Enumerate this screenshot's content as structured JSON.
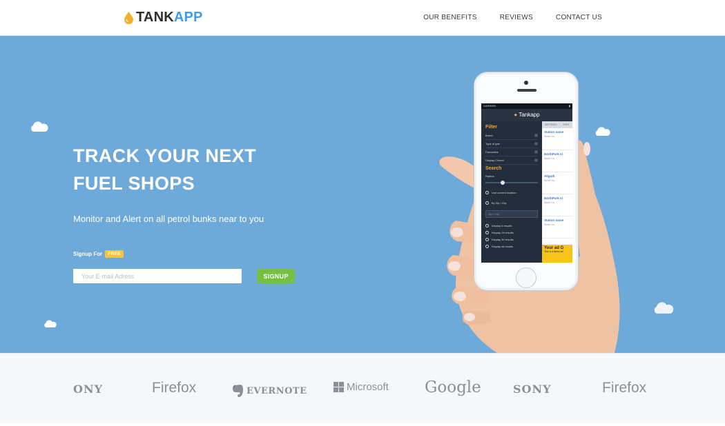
{
  "header": {
    "logo_part1": "TANK",
    "logo_part2": "APP",
    "nav": [
      "OUR BENEFITS",
      "REVIEWS",
      "CONTACT US"
    ]
  },
  "hero": {
    "headline_line1": "TRACK YOUR NEXT",
    "headline_line2": "FUEL SHOPS",
    "subline": "Monitor and Alert on all petrol bunks near to you",
    "signup_for": "Signup For",
    "free_badge": "FREE",
    "email_placeholder": "Your E-mail Adress",
    "signup_button": "SIGNUP"
  },
  "phone": {
    "carrier": "CARRIER",
    "app_title": "Tankapp",
    "filter_title": "Filter",
    "filter_rows": [
      "Brand",
      "Type of gas",
      "Favourites",
      "Display Closed"
    ],
    "search_title": "Search",
    "radius_label": "Radius",
    "options": [
      "Use current location",
      "By Zip / City"
    ],
    "city_placeholder": "Zip / City",
    "display_options": [
      "Display 5 results",
      "Display 25 results",
      "Display 50 results",
      "Display all results"
    ],
    "tabs_right": [
      "SETTINGS",
      "SORT"
    ],
    "results": [
      {
        "name": "Station name",
        "detail": "Street No."
      },
      {
        "name": "NorthPark st",
        "detail": "Street No."
      },
      {
        "name": "Allguth",
        "detail": "Street No."
      },
      {
        "name": "NorthPark st",
        "detail": "Street No."
      },
      {
        "name": "Station name",
        "detail": "Street No."
      }
    ],
    "ad_title": "Your ad G",
    "ad_sub": "This is a demo ad"
  },
  "logos": [
    "ONY",
    "Firefox",
    "EVERNOTE",
    "Microsoft",
    "Google",
    "SONY",
    "Firefox"
  ],
  "colors": {
    "hero_bg": "#6eaad9",
    "accent_blue": "#3d9be9",
    "signup_green": "#74c043",
    "badge_yellow": "#f8c33a",
    "logo_grey": "#8b9096"
  },
  "icons": [
    "fuel-drop-icon",
    "cloud-icon",
    "evernote-elephant-icon",
    "microsoft-windows-icon"
  ]
}
